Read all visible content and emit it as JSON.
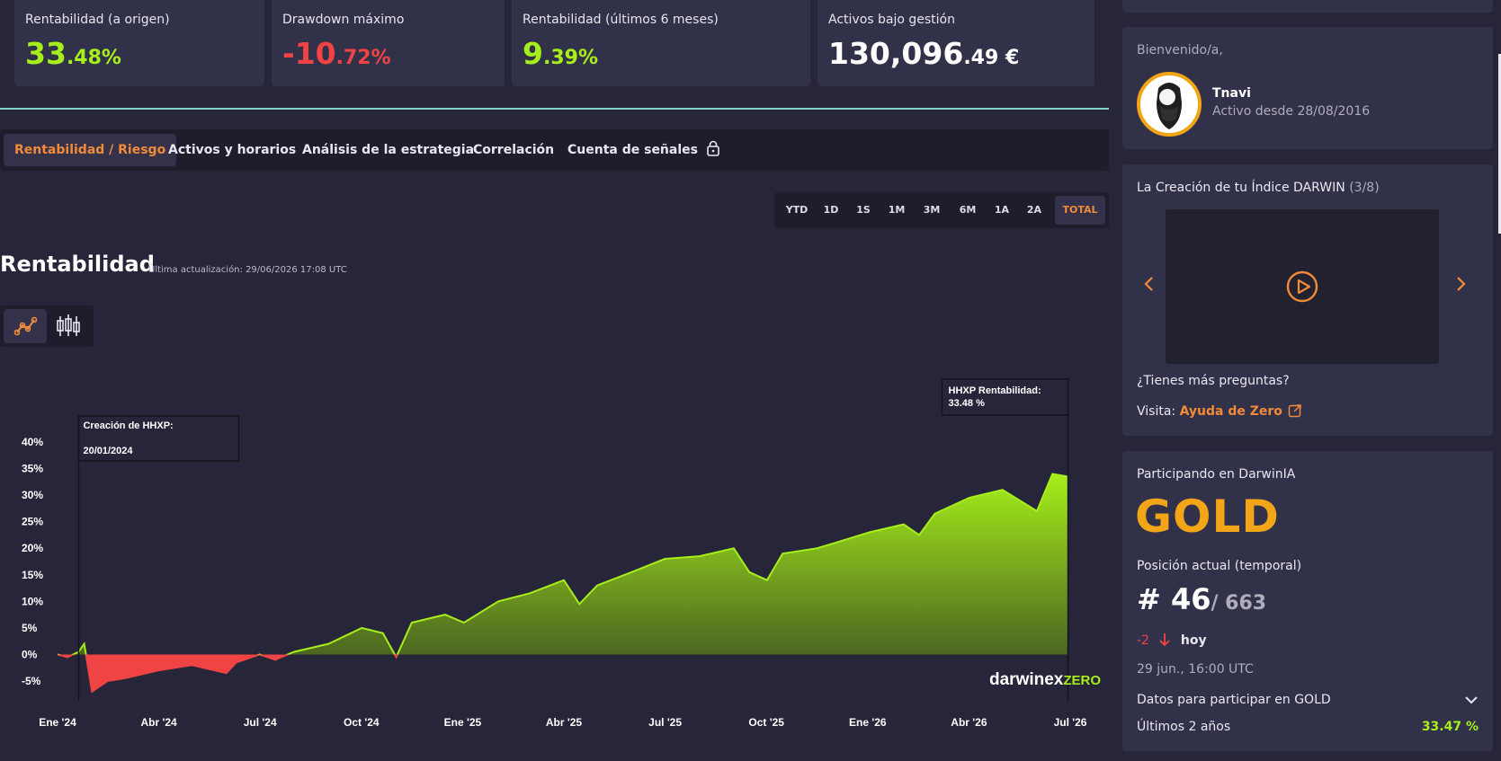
{
  "kpis": [
    {
      "label": "Rentabilidad (a origen)",
      "int": "33",
      "dec": ".48%",
      "color": "#a6ef1a"
    },
    {
      "label": "Drawdown máximo",
      "int": "-10",
      "dec": ".72%",
      "color": "#f04444"
    },
    {
      "label": "Rentabilidad (últimos 6 meses)",
      "int": "9",
      "dec": ".39%",
      "color": "#a6ef1a"
    },
    {
      "label": "Activos bajo gestión",
      "int": "130,096",
      "dec": ".49 €",
      "color": "#ffffff"
    }
  ],
  "tabs": [
    "Rentabilidad / Riesgo",
    "Activos y horarios",
    "Análisis de la estrategia",
    "Correlación",
    "Cuenta de señales"
  ],
  "active_tab": "Rentabilidad / Riesgo",
  "ranges": [
    "YTD",
    "1D",
    "1S",
    "1M",
    "3M",
    "6M",
    "1A",
    "2A",
    "TOTAL"
  ],
  "active_range": "TOTAL",
  "chart_title": "Rentabilidad",
  "last_update": "Última actualización: 29/06/2026 17:08 UTC",
  "colors": {
    "accent": "#f28a3a",
    "positive": "#a6ef1a",
    "negative": "#f04444",
    "gold": "#f2a516"
  },
  "chart_data": {
    "type": "area",
    "x_labels": [
      "Ene '24",
      "Abr '24",
      "Jul '24",
      "Oct '24",
      "Ene '25",
      "Abr '25",
      "Jul '25",
      "Oct '25",
      "Ene '26",
      "Abr '26",
      "Jul '26"
    ],
    "y_ticks": [
      "40%",
      "35%",
      "30%",
      "25%",
      "20%",
      "15%",
      "10%",
      "5%",
      "0%",
      "-5%"
    ],
    "ylim": [
      -5,
      40
    ],
    "grid": false,
    "series": [
      {
        "values": [
          [
            "2024-01-01",
            0
          ],
          [
            "2024-01-10",
            -0.5
          ],
          [
            "2024-01-20",
            0.5
          ],
          [
            "2024-01-25",
            2
          ],
          [
            "2024-02-01",
            -7
          ],
          [
            "2024-02-15",
            -5
          ],
          [
            "2024-03-01",
            -4.5
          ],
          [
            "2024-04-01",
            -3
          ],
          [
            "2024-05-01",
            -2
          ],
          [
            "2024-06-01",
            -3.5
          ],
          [
            "2024-06-10",
            -1.5
          ],
          [
            "2024-07-01",
            0
          ],
          [
            "2024-07-15",
            -1
          ],
          [
            "2024-08-01",
            0.5
          ],
          [
            "2024-09-01",
            2
          ],
          [
            "2024-10-01",
            5
          ],
          [
            "2024-10-20",
            4
          ],
          [
            "2024-11-01",
            -0.5
          ],
          [
            "2024-11-15",
            6
          ],
          [
            "2024-12-15",
            7.5
          ],
          [
            "2025-01-01",
            6
          ],
          [
            "2025-02-01",
            10
          ],
          [
            "2025-03-01",
            11.5
          ],
          [
            "2025-04-01",
            14
          ],
          [
            "2025-04-15",
            9.5
          ],
          [
            "2025-05-01",
            13
          ],
          [
            "2025-06-01",
            15.5
          ],
          [
            "2025-07-01",
            18
          ],
          [
            "2025-08-01",
            18.5
          ],
          [
            "2025-09-01",
            20
          ],
          [
            "2025-09-15",
            15.5
          ],
          [
            "2025-10-01",
            14
          ],
          [
            "2025-10-15",
            19
          ],
          [
            "2025-11-15",
            20
          ],
          [
            "2025-12-01",
            21
          ],
          [
            "2026-01-01",
            23
          ],
          [
            "2026-02-01",
            24.5
          ],
          [
            "2026-02-15",
            22.5
          ],
          [
            "2026-03-01",
            26.5
          ],
          [
            "2026-04-01",
            29.5
          ],
          [
            "2026-05-01",
            31
          ],
          [
            "2026-06-01",
            27
          ],
          [
            "2026-06-15",
            34
          ],
          [
            "2026-06-29",
            33.48
          ]
        ]
      }
    ],
    "annotations": {
      "start": [
        "Creación de HHXP:",
        "20/01/2024"
      ],
      "end": [
        "HHXP Rentabilidad:",
        "33.48 %"
      ]
    }
  },
  "watermark": {
    "brand": "darwinex",
    "suffix": "ZERO"
  },
  "welcome": {
    "greeting": "Bienvenido/a,",
    "user": "Tnavi",
    "since": "Activo desde 28/08/2016"
  },
  "index_card": {
    "title": "La Creación de tu Índice DARWIN",
    "step": "(3/8)",
    "question": "¿Tienes más preguntas?",
    "visit": "Visita:",
    "link": "Ayuda de Zero"
  },
  "darwinia": {
    "title": "Participando en DarwinIA",
    "tier": "GOLD",
    "position_label": "Posición actual (temporal)",
    "rank": "# 46",
    "total": "/ 663",
    "change": "-2",
    "change_label": "hoy",
    "timestamp": "29 jun., 16:00 UTC",
    "details_label": "Datos para participar en GOLD",
    "period_label": "Últimos 2 años",
    "period_value": "33.47 %"
  }
}
